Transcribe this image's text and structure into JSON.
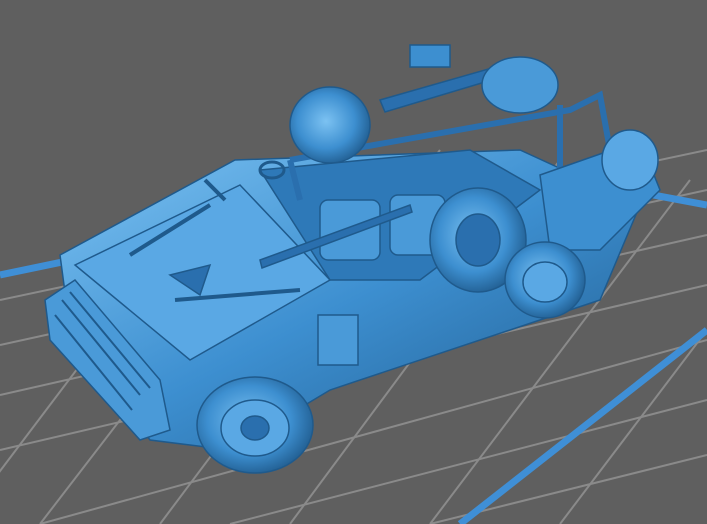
{
  "scene": {
    "subject": "3d-model-military-patrol-vehicle",
    "background_color": "#5f5f5f",
    "grid_line_color": "#8a8a8a",
    "build_plate_edge_color": "#3f8fd6",
    "model_color": "#3d8fd0",
    "model_shadow_color": "#1f5a8c",
    "model_highlight_color": "#7cc2f2"
  }
}
